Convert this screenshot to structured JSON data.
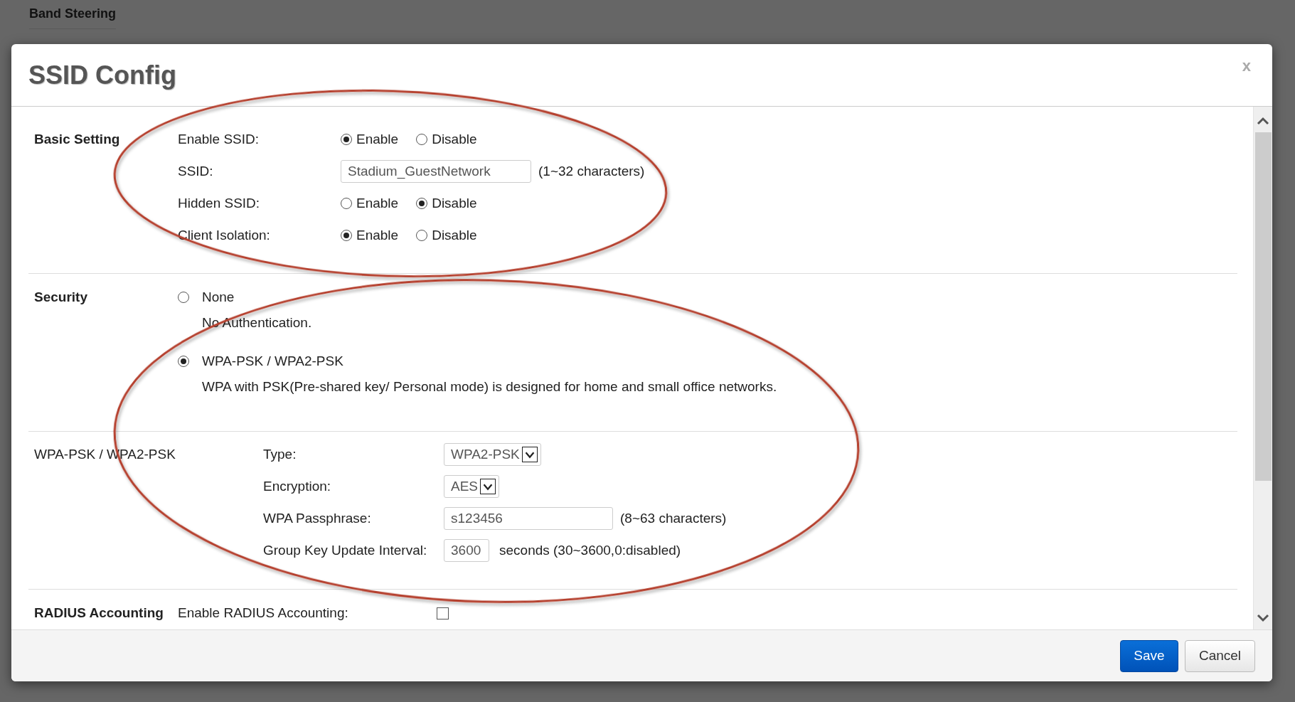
{
  "background": {
    "heading": "Band Steering"
  },
  "dialog": {
    "title": "SSID Config",
    "close": "x"
  },
  "basic_setting": {
    "heading": "Basic Setting",
    "rows": [
      {
        "label": "Enable SSID:",
        "kind": "radio",
        "options": [
          {
            "label": "Enable",
            "selected": true
          },
          {
            "label": "Disable",
            "selected": false
          }
        ]
      },
      {
        "label": "SSID:",
        "kind": "text",
        "value": "Stadium_GuestNetwork",
        "hint": "(1~32 characters)"
      },
      {
        "label": "Hidden SSID:",
        "kind": "radio",
        "options": [
          {
            "label": "Enable",
            "selected": false
          },
          {
            "label": "Disable",
            "selected": true
          }
        ]
      },
      {
        "label": "Client Isolation:",
        "kind": "radio",
        "options": [
          {
            "label": "Enable",
            "selected": true
          },
          {
            "label": "Disable",
            "selected": false
          }
        ]
      }
    ]
  },
  "security": {
    "heading": "Security",
    "options": [
      {
        "label": "None",
        "description": "No Authentication.",
        "selected": false
      },
      {
        "label": "WPA-PSK / WPA2-PSK",
        "description": "WPA with PSK(Pre-shared key/ Personal mode) is designed for home and small office networks.",
        "selected": true
      }
    ]
  },
  "wpa_settings": {
    "heading": "WPA-PSK / WPA2-PSK",
    "rows": [
      {
        "label": "Type:",
        "kind": "select",
        "value": "WPA2-PSK"
      },
      {
        "label": "Encryption:",
        "kind": "select",
        "value": "AES"
      },
      {
        "label": "WPA Passphrase:",
        "kind": "text",
        "value": "s123456",
        "hint": "(8~63 characters)"
      },
      {
        "label": "Group Key Update Interval:",
        "kind": "number",
        "value": "3600",
        "hint": "seconds (30~3600,0:disabled)"
      }
    ]
  },
  "radius_accounting": {
    "heading": "RADIUS Accounting",
    "label": "Enable RADIUS Accounting:",
    "checked": false
  },
  "buttons": [
    {
      "label": "Save",
      "kind": "primary"
    },
    {
      "label": "Cancel",
      "kind": "secondary"
    }
  ]
}
